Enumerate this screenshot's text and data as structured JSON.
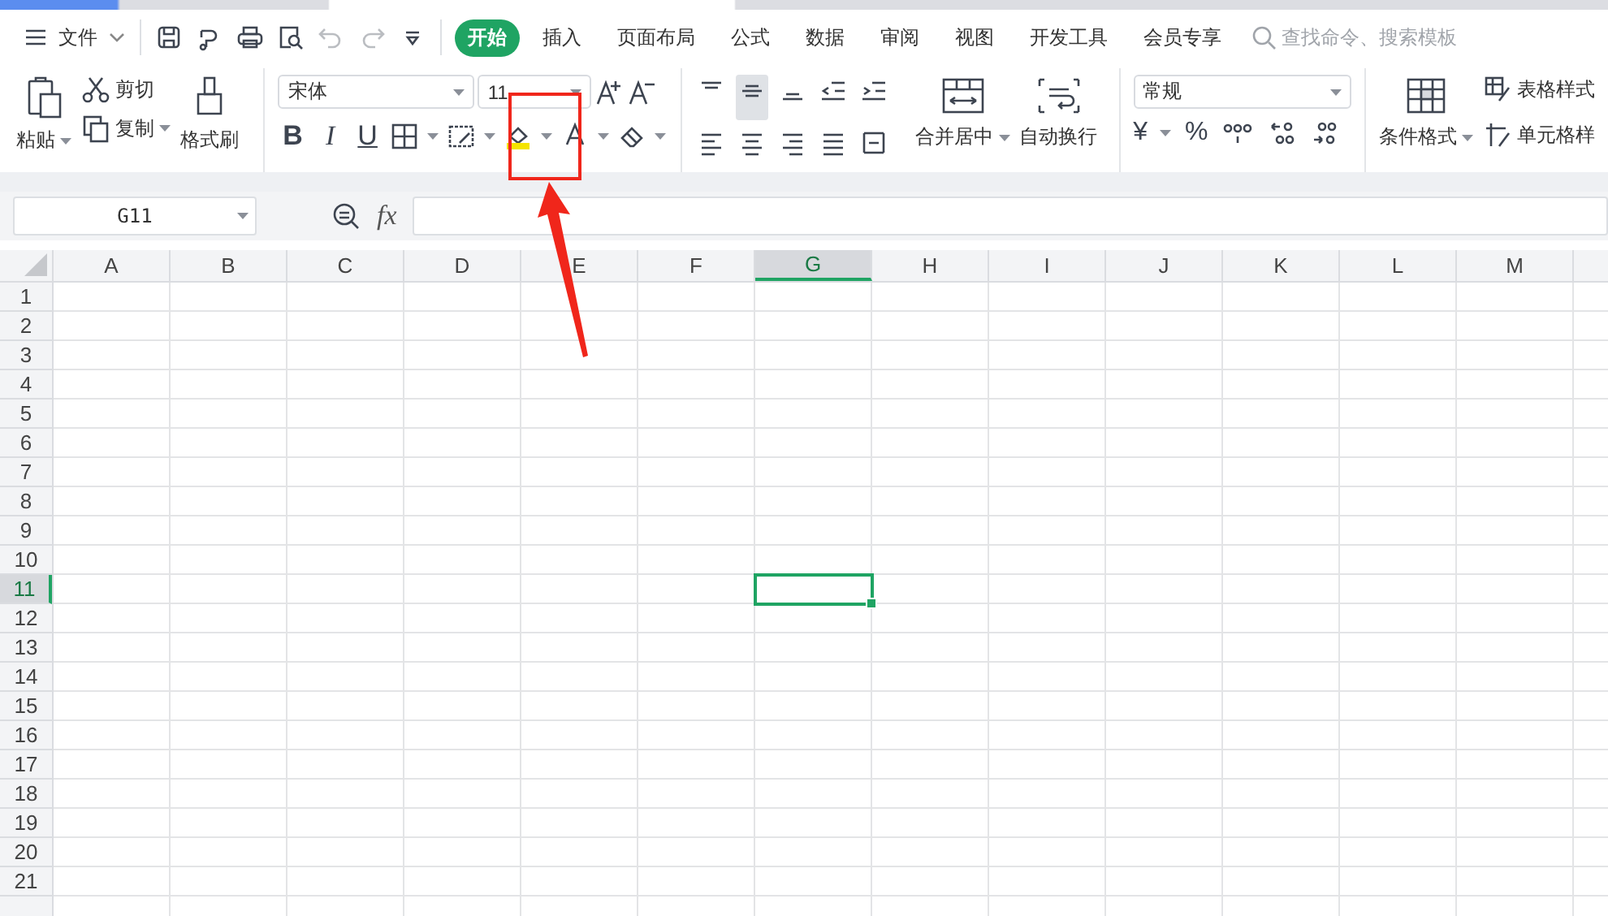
{
  "menu": {
    "file": "文件"
  },
  "quick_toolbar": [
    {
      "kind": "save",
      "disabled": false
    },
    {
      "kind": "painter",
      "disabled": false
    },
    {
      "kind": "print",
      "disabled": false
    },
    {
      "kind": "preview",
      "disabled": false
    },
    {
      "kind": "undo",
      "disabled": true
    },
    {
      "kind": "redo",
      "disabled": true
    },
    {
      "kind": "more",
      "disabled": false
    }
  ],
  "tabs": [
    {
      "label": "开始",
      "selected": true
    },
    {
      "label": "插入",
      "selected": false
    },
    {
      "label": "页面布局",
      "selected": false
    },
    {
      "label": "公式",
      "selected": false
    },
    {
      "label": "数据",
      "selected": false
    },
    {
      "label": "审阅",
      "selected": false
    },
    {
      "label": "视图",
      "selected": false
    },
    {
      "label": "开发工具",
      "selected": false
    },
    {
      "label": "会员专享",
      "selected": false
    }
  ],
  "search": {
    "placeholder": "查找命令、搜索模板"
  },
  "ribbon": {
    "paste": "粘贴",
    "cut": "剪切",
    "copy": "复制",
    "format_painter": "格式刷",
    "font_name": "宋体",
    "font_size": "11",
    "merge_center": "合并居中",
    "wrap_text": "自动换行",
    "number_format": "常规",
    "currency": "¥",
    "percent": "%",
    "conditional_format": "条件格式",
    "table_style": "表格样式",
    "cell_style": "单元格样"
  },
  "font_buttons": [
    {
      "kind": "bold",
      "label": "B"
    },
    {
      "kind": "italic",
      "label": "I"
    },
    {
      "kind": "underline",
      "label": "U"
    }
  ],
  "align_buttons": [
    {
      "kind": "top",
      "selected": false
    },
    {
      "kind": "middle",
      "selected": true
    },
    {
      "kind": "bottom",
      "selected": false
    },
    {
      "kind": "outdent",
      "selected": false
    },
    {
      "kind": "indent",
      "selected": false
    },
    {
      "kind": "left",
      "selected": false
    },
    {
      "kind": "center",
      "selected": false
    },
    {
      "kind": "right",
      "selected": false
    },
    {
      "kind": "justify",
      "selected": false
    },
    {
      "kind": "distributed",
      "selected": false
    }
  ],
  "name_box": "G11",
  "formula_bar": {
    "fx": "fx"
  },
  "columns": [
    {
      "label": "A",
      "selected": false
    },
    {
      "label": "B",
      "selected": false
    },
    {
      "label": "C",
      "selected": false
    },
    {
      "label": "D",
      "selected": false
    },
    {
      "label": "E",
      "selected": false
    },
    {
      "label": "F",
      "selected": false
    },
    {
      "label": "G",
      "selected": true
    },
    {
      "label": "H",
      "selected": false
    },
    {
      "label": "I",
      "selected": false
    },
    {
      "label": "J",
      "selected": false
    },
    {
      "label": "K",
      "selected": false
    },
    {
      "label": "L",
      "selected": false
    },
    {
      "label": "M",
      "selected": false
    }
  ],
  "rows": [
    {
      "label": "1",
      "selected": false
    },
    {
      "label": "2",
      "selected": false
    },
    {
      "label": "3",
      "selected": false
    },
    {
      "label": "4",
      "selected": false
    },
    {
      "label": "5",
      "selected": false
    },
    {
      "label": "6",
      "selected": false
    },
    {
      "label": "7",
      "selected": false
    },
    {
      "label": "8",
      "selected": false
    },
    {
      "label": "9",
      "selected": false
    },
    {
      "label": "10",
      "selected": false
    },
    {
      "label": "11",
      "selected": true
    },
    {
      "label": "12",
      "selected": false
    },
    {
      "label": "13",
      "selected": false
    },
    {
      "label": "14",
      "selected": false
    },
    {
      "label": "15",
      "selected": false
    },
    {
      "label": "16",
      "selected": false
    },
    {
      "label": "17",
      "selected": false
    },
    {
      "label": "18",
      "selected": false
    },
    {
      "label": "19",
      "selected": false
    },
    {
      "label": "20",
      "selected": false
    },
    {
      "label": "21",
      "selected": false
    }
  ]
}
